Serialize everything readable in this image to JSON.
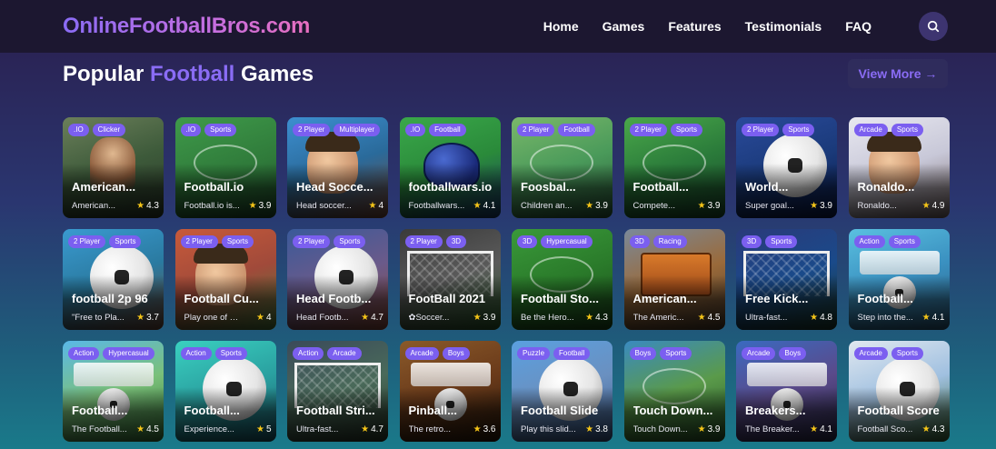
{
  "header": {
    "logo": "OnlineFootballBros.com",
    "nav": [
      "Home",
      "Games",
      "Features",
      "Testimonials",
      "FAQ"
    ],
    "search_icon": "search-icon"
  },
  "section": {
    "title_prefix": "Popular",
    "title_accent": "Football",
    "title_suffix": "Games",
    "view_more": "View More →"
  },
  "colors": {
    "accent": "#8a6cf5",
    "tag_bg": "#7b5ff0",
    "nav_bg": "#1c1730",
    "star": "#f5c518"
  },
  "games": [
    {
      "tags": [
        ".IO",
        "Clicker"
      ],
      "title": "American...",
      "desc": "American...",
      "rating": "4.3",
      "bg": "linear-gradient(160deg,#6b7f5a,#3d5a3a 50%,#2c3a2a)",
      "scene": "stadium"
    },
    {
      "tags": [
        ".IO",
        "Sports"
      ],
      "title": "Football.io",
      "desc": "Football.io is...",
      "rating": "3.9",
      "bg": "linear-gradient(160deg,#3f9a4a,#2f7a3a 55%,#1f4a2a)",
      "scene": "field"
    },
    {
      "tags": [
        "2 Player",
        "Multiplayer"
      ],
      "title": "Head Socce...",
      "desc": "Head soccer...",
      "rating": "4",
      "bg": "linear-gradient(160deg,#3d8fd0,#2a6a9a 50%,#7a4a3a)",
      "scene": "face"
    },
    {
      "tags": [
        ".IO",
        "Football"
      ],
      "title": "footballwars.io",
      "desc": "Footballwars...",
      "rating": "4.1",
      "bg": "linear-gradient(160deg,#3aa84a,#2a8a3a 50%,#1a3a6a)",
      "scene": "helmet"
    },
    {
      "tags": [
        "2 Player",
        "Football"
      ],
      "title": "Foosbal...",
      "desc": "Children an...",
      "rating": "3.9",
      "bg": "linear-gradient(160deg,#7ab86a,#4a9a5a 50%,#2a5a3a)",
      "scene": "foosball"
    },
    {
      "tags": [
        "2 Player",
        "Sports"
      ],
      "title": "Football...",
      "desc": "Compete...",
      "rating": "3.9",
      "bg": "linear-gradient(160deg,#4aa84a,#2a7a3a 50%,#1a4a2a)",
      "scene": "field"
    },
    {
      "tags": [
        "2 Player",
        "Sports"
      ],
      "title": "World...",
      "desc": "Super goal...",
      "rating": "3.9",
      "bg": "linear-gradient(160deg,#2a4a9a,#1a3a7a 50%,#0a1a4a)",
      "scene": "ball"
    },
    {
      "tags": [
        "Arcade",
        "Sports"
      ],
      "title": "Ronaldo...",
      "desc": "Ronaldo...",
      "rating": "4.9",
      "bg": "linear-gradient(160deg,#e8e8f0,#c8c8d8 50%,#7a6a6a)",
      "scene": "face"
    },
    {
      "tags": [
        "2 Player",
        "Sports"
      ],
      "title": "football 2p 96",
      "desc": "\"Free to Pla...",
      "rating": "3.7",
      "bg": "linear-gradient(160deg,#3a9ad0,#2a7aa0 50%,#6a4a3a)",
      "scene": "ball"
    },
    {
      "tags": [
        "2 Player",
        "Sports"
      ],
      "title": "Football Cu...",
      "desc": "Play one of th...",
      "rating": "4",
      "bg": "linear-gradient(160deg,#c85a3a,#a04a3a 50%,#4a7a3a)",
      "scene": "face"
    },
    {
      "tags": [
        "2 Player",
        "Sports"
      ],
      "title": "Head Footb...",
      "desc": "Head Footb...",
      "rating": "4.7",
      "bg": "linear-gradient(160deg,#3a5a9a,#6a5a8a 50%,#8a4a3a)",
      "scene": "ball"
    },
    {
      "tags": [
        "2 Player",
        "3D"
      ],
      "title": "FootBall 2021",
      "desc": "✿Soccer...",
      "rating": "3.9",
      "bg": "linear-gradient(160deg,#3a3a3a,#5a5a5a 50%,#2a5a2a)",
      "scene": "goal"
    },
    {
      "tags": [
        "3D",
        "Hypercasual"
      ],
      "title": "Football Sto...",
      "desc": "Be the Hero...",
      "rating": "4.3",
      "bg": "linear-gradient(160deg,#3a9a3a,#2a7a2a 50%,#1a4a1a)",
      "scene": "field"
    },
    {
      "tags": [
        "3D",
        "Racing"
      ],
      "title": "American...",
      "desc": "The Americ...",
      "rating": "4.5",
      "bg": "linear-gradient(160deg,#7a8a9a,#9a6a3a 50%,#4a3a2a)",
      "scene": "bus"
    },
    {
      "tags": [
        "3D",
        "Sports"
      ],
      "title": "Free Kick...",
      "desc": "Ultra-fast...",
      "rating": "4.8",
      "bg": "linear-gradient(160deg,#2a3a7a,#1a4a8a 50%,#1a3a2a)",
      "scene": "goal"
    },
    {
      "tags": [
        "Action",
        "Sports"
      ],
      "title": "Football...",
      "desc": "Step into the...",
      "rating": "4.1",
      "bg": "linear-gradient(160deg,#5ac0e0,#3a90c0 50%,#2a5a7a)",
      "scene": "league"
    },
    {
      "tags": [
        "Action",
        "Hypercasual"
      ],
      "title": "Football...",
      "desc": "The Football...",
      "rating": "4.5",
      "bg": "linear-gradient(160deg,#5ab8e8,#7ac07a 50%,#3a7a3a)",
      "scene": "panda"
    },
    {
      "tags": [
        "Action",
        "Sports"
      ],
      "title": "Football...",
      "desc": "Experience...",
      "rating": "5",
      "bg": "linear-gradient(160deg,#3ad0c0,#2aa0a0 50%,#1a5a6a)",
      "scene": "ball"
    },
    {
      "tags": [
        "Action",
        "Arcade"
      ],
      "title": "Football Stri...",
      "desc": "Ultra-fast...",
      "rating": "4.7",
      "bg": "linear-gradient(160deg,#3a4a5a,#4a6a5a 50%,#2a3a2a)",
      "scene": "goal"
    },
    {
      "tags": [
        "Arcade",
        "Boys"
      ],
      "title": "Pinball...",
      "desc": "The retro...",
      "rating": "3.6",
      "bg": "linear-gradient(160deg,#8a5a2a,#6a3a1a 50%,#2a1a0a)",
      "scene": "pinball"
    },
    {
      "tags": [
        "Puzzle",
        "Football"
      ],
      "title": "Football Slide",
      "desc": "Play this slid...",
      "rating": "3.8",
      "bg": "linear-gradient(160deg,#5aa0e0,#6a90c0 50%,#3a5a8a)",
      "scene": "ball"
    },
    {
      "tags": [
        "Boys",
        "Sports"
      ],
      "title": "Touch Down...",
      "desc": "Touch Down...",
      "rating": "3.9",
      "bg": "linear-gradient(160deg,#3a8ac0,#5a9a4a 50%,#2a5a2a)",
      "scene": "field"
    },
    {
      "tags": [
        "Arcade",
        "Boys"
      ],
      "title": "Breakers...",
      "desc": "The Breaker...",
      "rating": "4.1",
      "bg": "linear-gradient(160deg,#3a6ac0,#5a4a8a 50%,#2a2a4a)",
      "scene": "breakers"
    },
    {
      "tags": [
        "Arcade",
        "Sports"
      ],
      "title": "Football Score",
      "desc": "Football Sco...",
      "rating": "4.3",
      "bg": "linear-gradient(160deg,#e0e8f0,#a0c0e0 50%,#3a6a3a)",
      "scene": "ball"
    }
  ]
}
